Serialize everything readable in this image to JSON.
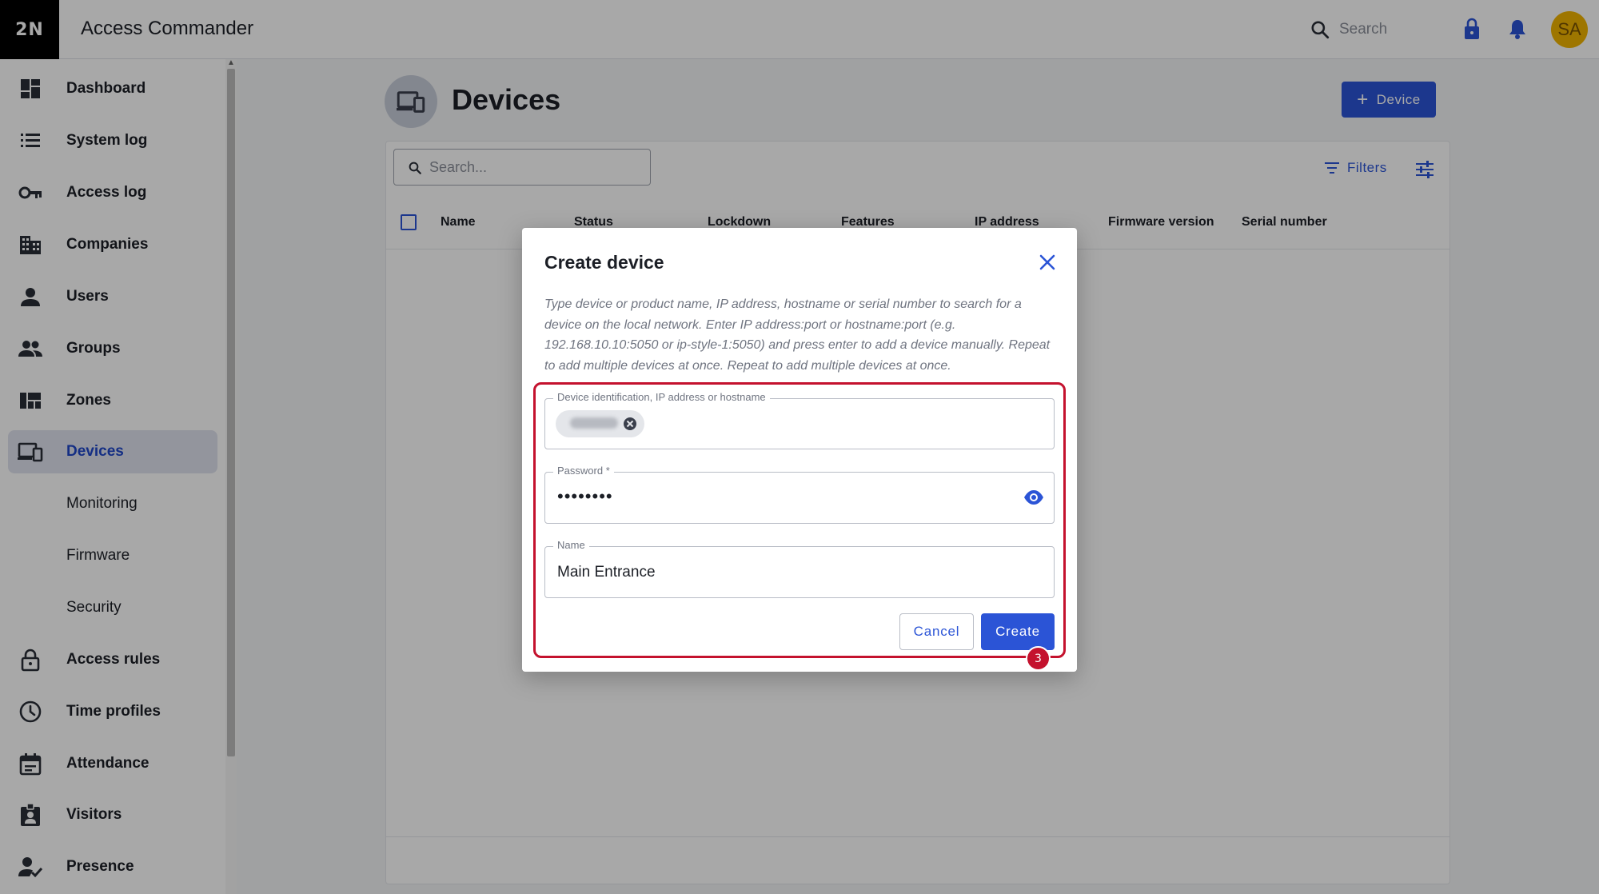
{
  "app": {
    "logo": "2N",
    "title": "Access Commander"
  },
  "topbar": {
    "search_label": "Search",
    "avatar_initials": "SA"
  },
  "sidebar": {
    "items": [
      {
        "label": "Dashboard",
        "icon": "dashboard-icon"
      },
      {
        "label": "System log",
        "icon": "list-icon"
      },
      {
        "label": "Access log",
        "icon": "key-icon"
      },
      {
        "label": "Companies",
        "icon": "building-icon"
      },
      {
        "label": "Users",
        "icon": "user-icon"
      },
      {
        "label": "Groups",
        "icon": "group-icon"
      },
      {
        "label": "Zones",
        "icon": "zones-icon"
      },
      {
        "label": "Devices",
        "icon": "devices-icon",
        "active": true
      },
      {
        "label": "Monitoring"
      },
      {
        "label": "Firmware"
      },
      {
        "label": "Security"
      },
      {
        "label": "Access rules",
        "icon": "lock-icon"
      },
      {
        "label": "Time profiles",
        "icon": "clock-icon"
      },
      {
        "label": "Attendance",
        "icon": "calendar-icon"
      },
      {
        "label": "Visitors",
        "icon": "visitor-badge-icon"
      },
      {
        "label": "Presence",
        "icon": "person-check-icon"
      }
    ]
  },
  "page": {
    "title": "Devices",
    "add_button_label": "Device",
    "search_placeholder": "Search...",
    "filters_label": "Filters",
    "columns": [
      "Name",
      "Status",
      "Lockdown",
      "Features",
      "IP address",
      "Firmware version",
      "Serial number"
    ]
  },
  "dialog": {
    "title": "Create device",
    "description": "Type device or product name, IP address, hostname or serial number to search for a device on the local network. Enter IP address:port or hostname:port (e.g. 192.168.10.10:5050 or ip-style-1:5050) and press enter to add a device manually. Repeat to add multiple devices at once. Repeat to add multiple devices at once.",
    "device_field_label": "Device identification, IP address or hostname",
    "password_label": "Password *",
    "password_value": "••••••••",
    "name_label": "Name",
    "name_value": "Main Entrance",
    "cancel_label": "Cancel",
    "create_label": "Create",
    "step_number": "3"
  },
  "colors": {
    "accent": "#2b54d6",
    "highlight": "#c4122e",
    "avatar": "#f0b400"
  }
}
